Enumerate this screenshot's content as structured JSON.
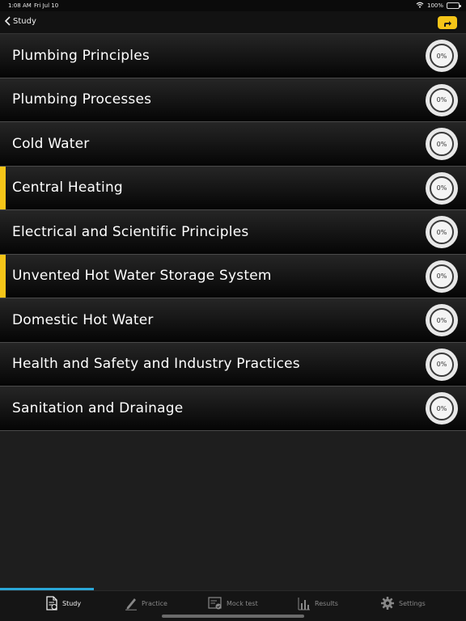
{
  "status_bar": {
    "time": "1:08 AM",
    "date": "Fri Jul 10",
    "battery": "100%"
  },
  "nav": {
    "back_label": "Study"
  },
  "topics": [
    {
      "label": "Plumbing Principles",
      "progress": "0%",
      "highlighted": false
    },
    {
      "label": "Plumbing Processes",
      "progress": "0%",
      "highlighted": false
    },
    {
      "label": "Cold Water",
      "progress": "0%",
      "highlighted": false
    },
    {
      "label": "Central Heating",
      "progress": "0%",
      "highlighted": true
    },
    {
      "label": "Electrical and Scientific Principles",
      "progress": "0%",
      "highlighted": false
    },
    {
      "label": "Unvented Hot Water Storage System",
      "progress": "0%",
      "highlighted": true
    },
    {
      "label": "Domestic Hot Water",
      "progress": "0%",
      "highlighted": false
    },
    {
      "label": "Health and Safety and Industry Practices",
      "progress": "0%",
      "highlighted": false
    },
    {
      "label": "Sanitation and Drainage",
      "progress": "0%",
      "highlighted": false
    }
  ],
  "tabs": [
    {
      "label": "Study",
      "icon": "document-icon",
      "active": true
    },
    {
      "label": "Practice",
      "icon": "pencil-icon",
      "active": false
    },
    {
      "label": "Mock test",
      "icon": "test-sheet-icon",
      "active": false
    },
    {
      "label": "Results",
      "icon": "bar-chart-icon",
      "active": false
    },
    {
      "label": "Settings",
      "icon": "gear-icon",
      "active": false
    }
  ],
  "colors": {
    "accent": "#f5c518",
    "tab_indicator": "#2aa7d8"
  }
}
